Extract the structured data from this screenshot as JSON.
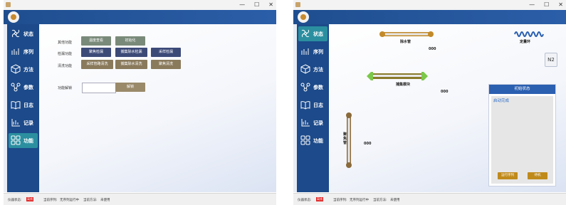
{
  "nav": [
    {
      "label": "状态",
      "icon": "fan-icon"
    },
    {
      "label": "序列",
      "icon": "sequence-icon"
    },
    {
      "label": "方法",
      "icon": "cube-icon"
    },
    {
      "label": "参数",
      "icon": "nodes-icon"
    },
    {
      "label": "日志",
      "icon": "book-icon"
    },
    {
      "label": "记录",
      "icon": "chart-icon"
    },
    {
      "label": "功能",
      "icon": "grid-icon"
    }
  ],
  "window_controls": [
    "—",
    "☐",
    "✕"
  ],
  "status_bar": {
    "device_label": "仪器状态:",
    "device_badge": "离线",
    "sequence_label": "当前序列:",
    "sequence_value": "无序列运行中",
    "method_label": "当前方法:",
    "method_value": "未使用"
  },
  "functions": {
    "rows": [
      {
        "label": "其他功能",
        "buttons": [
          "温度查看",
          "初始化"
        ]
      },
      {
        "label": "检漏功能",
        "buttons": [
          "聚焦检漏",
          "捕集除水检漏",
          "采样检漏"
        ]
      },
      {
        "label": "清洗功能",
        "buttons": [
          "采样管路清洗",
          "捕集除水清洗",
          "聚焦清洗"
        ]
      }
    ],
    "other_label": "功能解锁",
    "unlock_button": "解锁",
    "unlock_value": ""
  },
  "status_view": {
    "water_pipe": "除水管",
    "water_value": "000",
    "trap_module": "捕集模块",
    "trap_value": "000",
    "focus_pipe": "聚焦管",
    "focus_value": "000",
    "quant_ring": "定量环",
    "n2_label": "N2",
    "panel_title": "初始状态",
    "panel_message": "启动完成",
    "btn_run": "运行序列",
    "btn_stop": "待机"
  }
}
